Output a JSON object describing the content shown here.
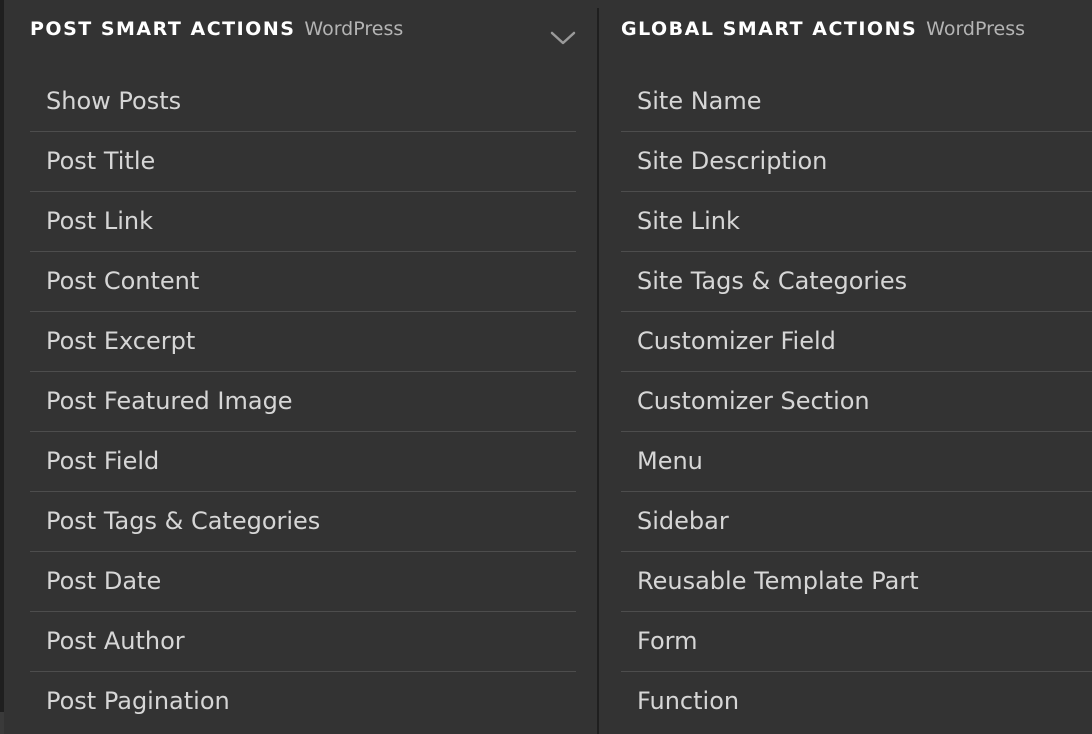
{
  "post_panel": {
    "title": "POST SMART ACTIONS",
    "source": "WordPress",
    "collapse_icon": "chevron-down-icon",
    "items": [
      "Show Posts",
      "Post Title",
      "Post Link",
      "Post Content",
      "Post Excerpt",
      "Post Featured Image",
      "Post Field",
      "Post Tags & Categories",
      "Post Date",
      "Post Author",
      "Post Pagination"
    ]
  },
  "global_panel": {
    "title": "GLOBAL SMART ACTIONS",
    "source": "WordPress",
    "items": [
      "Site Name",
      "Site Description",
      "Site Link",
      "Site Tags & Categories",
      "Customizer Field",
      "Customizer Section",
      "Menu",
      "Sidebar",
      "Reusable Template Part",
      "Form",
      "Function"
    ]
  },
  "colors": {
    "background": "#333333",
    "title": "#ffffff",
    "source": "#b4b4b4",
    "item_text": "#d6d6d6",
    "separator": "#4d4d4d",
    "divider": "#1f1f1f"
  }
}
